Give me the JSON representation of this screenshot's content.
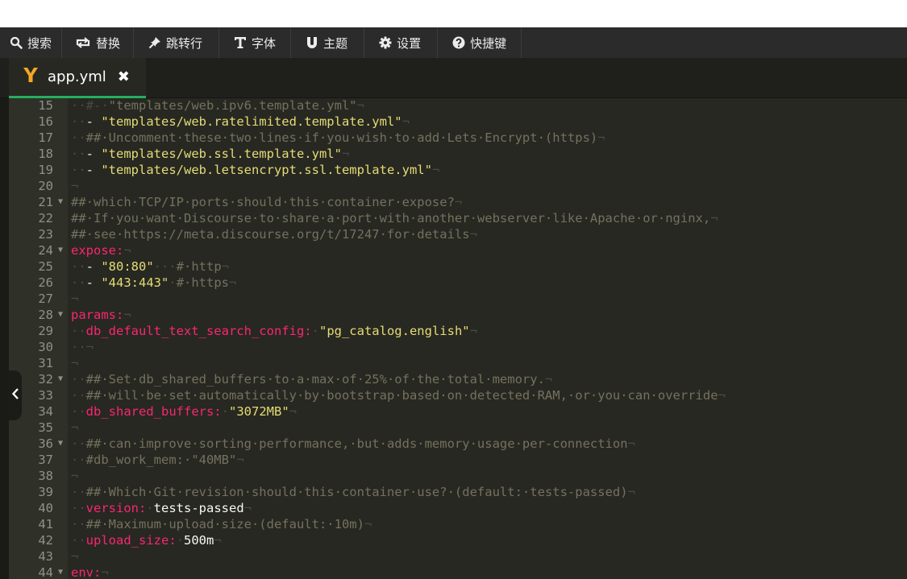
{
  "toolbar": {
    "buttons": [
      {
        "id": "search",
        "label": "搜索",
        "icon": "search-icon"
      },
      {
        "id": "replace",
        "label": "替换",
        "icon": "replace-icon"
      },
      {
        "id": "goto",
        "label": "跳转行",
        "icon": "pin-icon"
      },
      {
        "id": "font",
        "label": "字体",
        "icon": "text-icon"
      },
      {
        "id": "theme",
        "label": "主题",
        "icon": "theme-icon"
      },
      {
        "id": "settings",
        "label": "设置",
        "icon": "gear-icon"
      },
      {
        "id": "shortcuts",
        "label": "快捷键",
        "icon": "question-icon"
      }
    ]
  },
  "tab": {
    "filename": "app.yml",
    "icon": "yaml-icon",
    "close": "✖"
  },
  "colors": {
    "accent": "#27ae60",
    "tab_icon": "#f5a623",
    "editor_bg": "#272822",
    "gutter_bg": "#2f3129"
  },
  "editor": {
    "lines": [
      {
        "n": "15",
        "fold": false,
        "tokens": [
          [
            "ws",
            "··#-·"
          ],
          [
            "cm",
            "\"templates/web.ipv6.template.yml\""
          ],
          [
            "ws",
            "¬"
          ]
        ]
      },
      {
        "n": "16",
        "fold": false,
        "tokens": [
          [
            "ws",
            "··"
          ],
          [
            "val",
            "- "
          ],
          [
            "str",
            "\"templates/web.ratelimited.template.yml\""
          ],
          [
            "ws",
            "¬"
          ]
        ]
      },
      {
        "n": "17",
        "fold": false,
        "tokens": [
          [
            "ws",
            "··"
          ],
          [
            "cm",
            "##·Uncomment·these·two·lines·if·you·wish·to·add·Lets·Encrypt·(https)"
          ],
          [
            "ws",
            "¬"
          ]
        ]
      },
      {
        "n": "18",
        "fold": false,
        "tokens": [
          [
            "ws",
            "··"
          ],
          [
            "val",
            "- "
          ],
          [
            "str",
            "\"templates/web.ssl.template.yml\""
          ],
          [
            "ws",
            "¬"
          ]
        ]
      },
      {
        "n": "19",
        "fold": false,
        "tokens": [
          [
            "ws",
            "··"
          ],
          [
            "val",
            "- "
          ],
          [
            "str",
            "\"templates/web.letsencrypt.ssl.template.yml\""
          ],
          [
            "ws",
            "¬"
          ]
        ]
      },
      {
        "n": "20",
        "fold": false,
        "tokens": [
          [
            "ws",
            "¬"
          ]
        ]
      },
      {
        "n": "21",
        "fold": true,
        "tokens": [
          [
            "cm",
            "##·which·TCP/IP·ports·should·this·container·expose?"
          ],
          [
            "ws",
            "¬"
          ]
        ]
      },
      {
        "n": "22",
        "fold": false,
        "tokens": [
          [
            "cm",
            "##·If·you·want·Discourse·to·share·a·port·with·another·webserver·like·Apache·or·nginx,"
          ],
          [
            "ws",
            "¬"
          ]
        ]
      },
      {
        "n": "23",
        "fold": false,
        "tokens": [
          [
            "cm",
            "##·see·https://meta.discourse.org/t/17247·for·details"
          ],
          [
            "ws",
            "¬"
          ]
        ]
      },
      {
        "n": "24",
        "fold": true,
        "tokens": [
          [
            "key",
            "expose:"
          ],
          [
            "ws",
            "¬"
          ]
        ]
      },
      {
        "n": "25",
        "fold": false,
        "tokens": [
          [
            "ws",
            "··"
          ],
          [
            "val",
            "- "
          ],
          [
            "str",
            "\"80:80\""
          ],
          [
            "ws",
            "···"
          ],
          [
            "cm",
            "#·http"
          ],
          [
            "ws",
            "¬"
          ]
        ]
      },
      {
        "n": "26",
        "fold": false,
        "tokens": [
          [
            "ws",
            "··"
          ],
          [
            "val",
            "- "
          ],
          [
            "str",
            "\"443:443\""
          ],
          [
            "ws",
            "·"
          ],
          [
            "cm",
            "#·https"
          ],
          [
            "ws",
            "¬"
          ]
        ]
      },
      {
        "n": "27",
        "fold": false,
        "tokens": [
          [
            "ws",
            "¬"
          ]
        ]
      },
      {
        "n": "28",
        "fold": true,
        "tokens": [
          [
            "key",
            "params:"
          ],
          [
            "ws",
            "¬"
          ]
        ]
      },
      {
        "n": "29",
        "fold": false,
        "tokens": [
          [
            "ws",
            "··"
          ],
          [
            "key",
            "db_default_text_search_config:"
          ],
          [
            "ws",
            "·"
          ],
          [
            "str",
            "\"pg_catalog.english\""
          ],
          [
            "ws",
            "¬"
          ]
        ]
      },
      {
        "n": "30",
        "fold": false,
        "tokens": [
          [
            "ws",
            "··¬"
          ]
        ]
      },
      {
        "n": "31",
        "fold": false,
        "tokens": [
          [
            "ws",
            "¬"
          ]
        ]
      },
      {
        "n": "32",
        "fold": true,
        "tokens": [
          [
            "ws",
            "··"
          ],
          [
            "cm",
            "##·Set·db_shared_buffers·to·a·max·of·25%·of·the·total·memory."
          ],
          [
            "ws",
            "¬"
          ]
        ]
      },
      {
        "n": "33",
        "fold": false,
        "tokens": [
          [
            "ws",
            "··"
          ],
          [
            "cm",
            "##·will·be·set·automatically·by·bootstrap·based·on·detected·RAM,·or·you·can·override"
          ],
          [
            "ws",
            "¬"
          ]
        ]
      },
      {
        "n": "34",
        "fold": false,
        "tokens": [
          [
            "ws",
            "··"
          ],
          [
            "key",
            "db_shared_buffers:"
          ],
          [
            "ws",
            "·"
          ],
          [
            "str",
            "\"3072MB\""
          ],
          [
            "ws",
            "¬"
          ]
        ]
      },
      {
        "n": "35",
        "fold": false,
        "tokens": [
          [
            "ws",
            "¬"
          ]
        ]
      },
      {
        "n": "36",
        "fold": true,
        "tokens": [
          [
            "ws",
            "··"
          ],
          [
            "cm",
            "##·can·improve·sorting·performance,·but·adds·memory·usage·per-connection"
          ],
          [
            "ws",
            "¬"
          ]
        ]
      },
      {
        "n": "37",
        "fold": false,
        "tokens": [
          [
            "ws",
            "··"
          ],
          [
            "cm",
            "#db_work_mem:·\"40MB\""
          ],
          [
            "ws",
            "¬"
          ]
        ]
      },
      {
        "n": "38",
        "fold": false,
        "tokens": [
          [
            "ws",
            "¬"
          ]
        ]
      },
      {
        "n": "39",
        "fold": false,
        "tokens": [
          [
            "ws",
            "··"
          ],
          [
            "cm",
            "##·Which·Git·revision·should·this·container·use?·(default:·tests-passed)"
          ],
          [
            "ws",
            "¬"
          ]
        ]
      },
      {
        "n": "40",
        "fold": false,
        "tokens": [
          [
            "ws",
            "··"
          ],
          [
            "key",
            "version:"
          ],
          [
            "ws",
            "·"
          ],
          [
            "val",
            "tests-passed"
          ],
          [
            "ws",
            "¬"
          ]
        ]
      },
      {
        "n": "41",
        "fold": false,
        "tokens": [
          [
            "ws",
            "··"
          ],
          [
            "cm",
            "##·Maximum·upload·size·(default:·10m)"
          ],
          [
            "ws",
            "¬"
          ]
        ]
      },
      {
        "n": "42",
        "fold": false,
        "tokens": [
          [
            "ws",
            "··"
          ],
          [
            "key",
            "upload_size:"
          ],
          [
            "ws",
            "·"
          ],
          [
            "val",
            "500m"
          ],
          [
            "ws",
            "¬"
          ]
        ]
      },
      {
        "n": "43",
        "fold": false,
        "tokens": [
          [
            "ws",
            "¬"
          ]
        ]
      },
      {
        "n": "44",
        "fold": true,
        "tokens": [
          [
            "key",
            "env:"
          ],
          [
            "ws",
            "¬"
          ]
        ]
      }
    ]
  }
}
